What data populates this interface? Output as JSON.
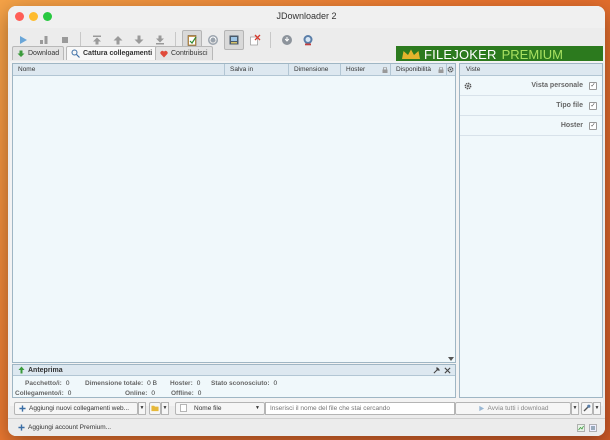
{
  "window": {
    "title": "JDownloader 2"
  },
  "tabs": [
    {
      "label": "Download"
    },
    {
      "label": "Cattura collegamenti"
    },
    {
      "label": "Contribuisci"
    }
  ],
  "banner": {
    "part1": "FILEJOKER",
    "part2": "PREMIUM"
  },
  "table": {
    "columns": [
      {
        "label": "Nome"
      },
      {
        "label": "Salva in"
      },
      {
        "label": "Dimensione"
      },
      {
        "label": "Hoster"
      },
      {
        "label": "Disponibilità"
      }
    ]
  },
  "sidepanel": {
    "header": "Viste",
    "options": [
      {
        "label": "Vista personale",
        "checked": true
      },
      {
        "label": "Tipo file",
        "checked": true
      },
      {
        "label": "Hoster",
        "checked": true
      }
    ]
  },
  "preview": {
    "title": "Anteprima",
    "stats": [
      {
        "label": "Pacchetto/i:",
        "value": "0"
      },
      {
        "label": "Dimensione totale:",
        "value": "0 B"
      },
      {
        "label": "Hoster:",
        "value": "0"
      },
      {
        "label": "Stato sconosciuto:",
        "value": "0"
      },
      {
        "label": "Collegamento/i:",
        "value": "0"
      },
      {
        "label": "Online:",
        "value": "0"
      },
      {
        "label": "Offline:",
        "value": "0"
      }
    ]
  },
  "bottombar": {
    "add_links_label": "Aggiungi nuovi collegamenti web...",
    "filter_field": "Nome file",
    "search_placeholder": "Inserisci il nome del file che stai cercando",
    "start_all_label": "Avvia tutti i download"
  },
  "statusbar": {
    "add_account_label": "Aggiungi account Premium..."
  },
  "colors": {
    "accent_green": "#2c7a1e",
    "banner_text_green": "#a8e060",
    "panel_bg": "#f0f8fb"
  },
  "icons": [
    "play-icon",
    "pause-icon",
    "stop-icon",
    "move-top-icon",
    "move-up-icon",
    "move-down-icon",
    "move-bottom-icon",
    "clipboard-icon",
    "reconnect-icon",
    "auto-confirm-icon",
    "clear-icon",
    "update-icon",
    "premium-icon"
  ]
}
